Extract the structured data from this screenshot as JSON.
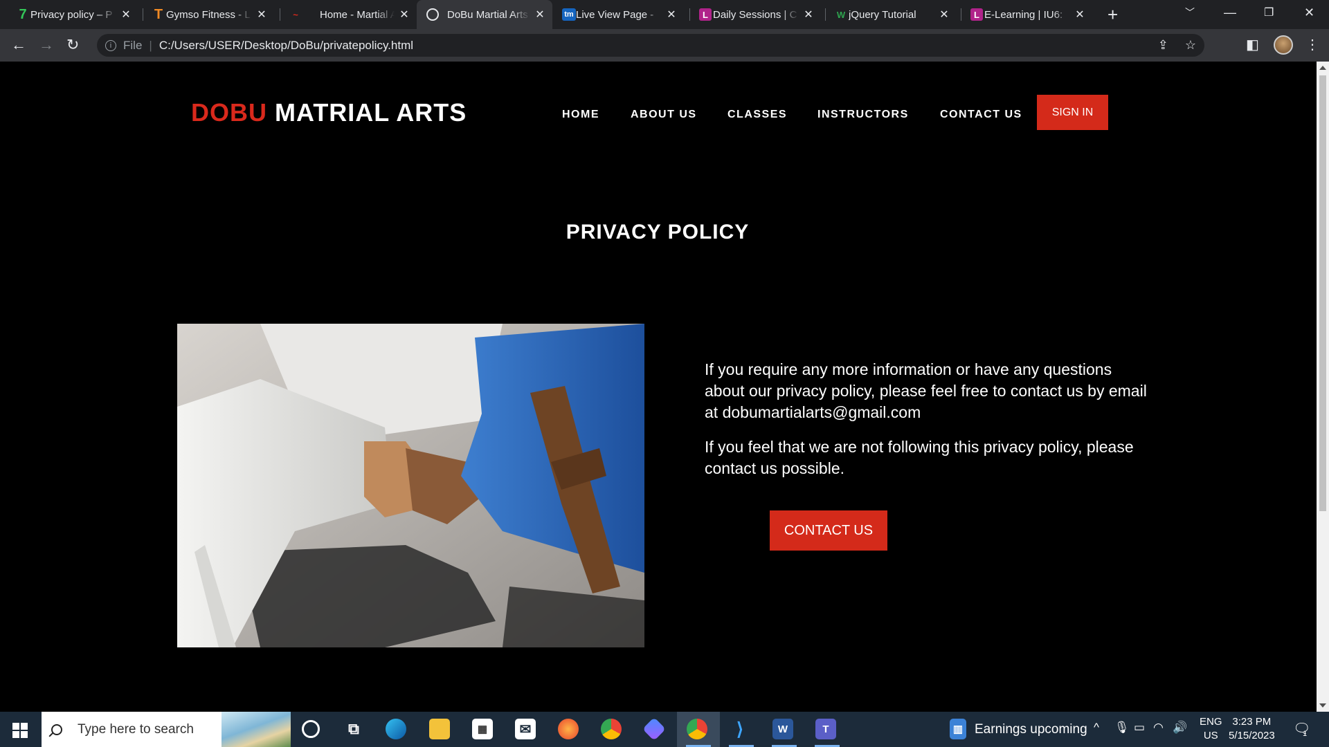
{
  "browser": {
    "tabs": [
      {
        "title": "Privacy policy – P",
        "favicon": "7"
      },
      {
        "title": "Gymso Fitness - L",
        "favicon": "T"
      },
      {
        "title": "Home - Martial A",
        "favicon": "~"
      },
      {
        "title": "DoBu Martial Arts",
        "favicon": "globe"
      },
      {
        "title": "Live View Page - ",
        "favicon": "tm"
      },
      {
        "title": "Daily Sessions | C",
        "favicon": "L"
      },
      {
        "title": "jQuery Tutorial",
        "favicon": "W"
      },
      {
        "title": "E-Learning | IU6:",
        "favicon": "L"
      }
    ],
    "active_tab_index": 3,
    "address_scheme": "File",
    "address": "C:/Users/USER/Desktop/DoBu/privatepolicy.html"
  },
  "site": {
    "logo_part1": "DOBU",
    "logo_part2": " MATRIAL ARTS",
    "nav": [
      "HOME",
      "ABOUT US",
      "CLASSES",
      "INSTRUCTORS",
      "CONTACT US"
    ],
    "signin_label": "SIGN IN",
    "accent_color": "#d42a1a"
  },
  "main": {
    "title": "PRIVACY POLICY",
    "para1": "If you require any more information or have any questions about our privacy policy, please feel free to contact us by email at dobumartialarts@gmail.com",
    "para2": "If you feel that we are not following this privacy policy, please contact us possible.",
    "contact_button": "CONTACT US"
  },
  "taskbar": {
    "search_placeholder": "Type here to search",
    "news": "Earnings upcoming",
    "lang_top": "ENG",
    "lang_bottom": "US",
    "time": "3:23 PM",
    "date": "5/15/2023",
    "notification_count": "1"
  }
}
